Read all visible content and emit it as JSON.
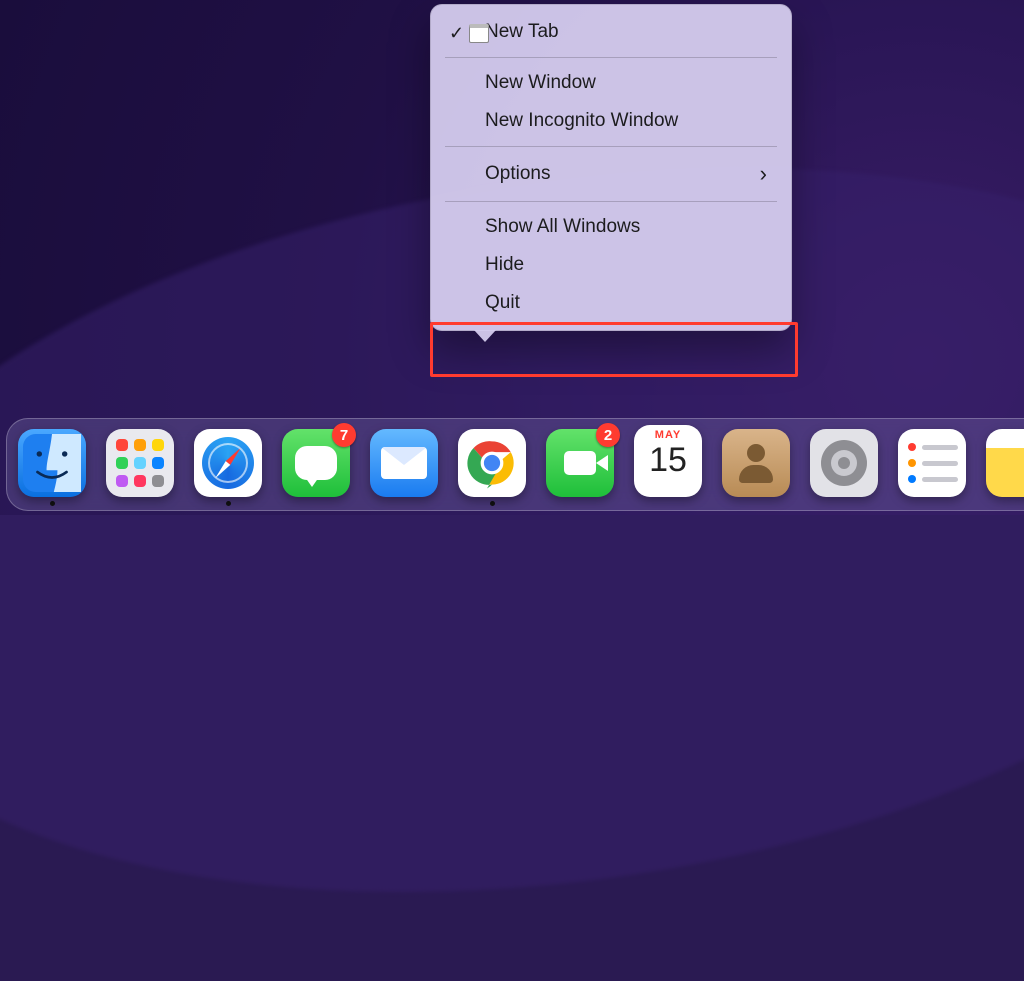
{
  "menu": {
    "new_tab": "New Tab",
    "new_window": "New Window",
    "new_incognito": "New Incognito Window",
    "options": "Options",
    "show_all": "Show All Windows",
    "hide": "Hide",
    "quit": "Quit"
  },
  "calendar": {
    "month": "MAY",
    "day": "15"
  },
  "badges": {
    "messages": "7",
    "facetime": "2"
  }
}
